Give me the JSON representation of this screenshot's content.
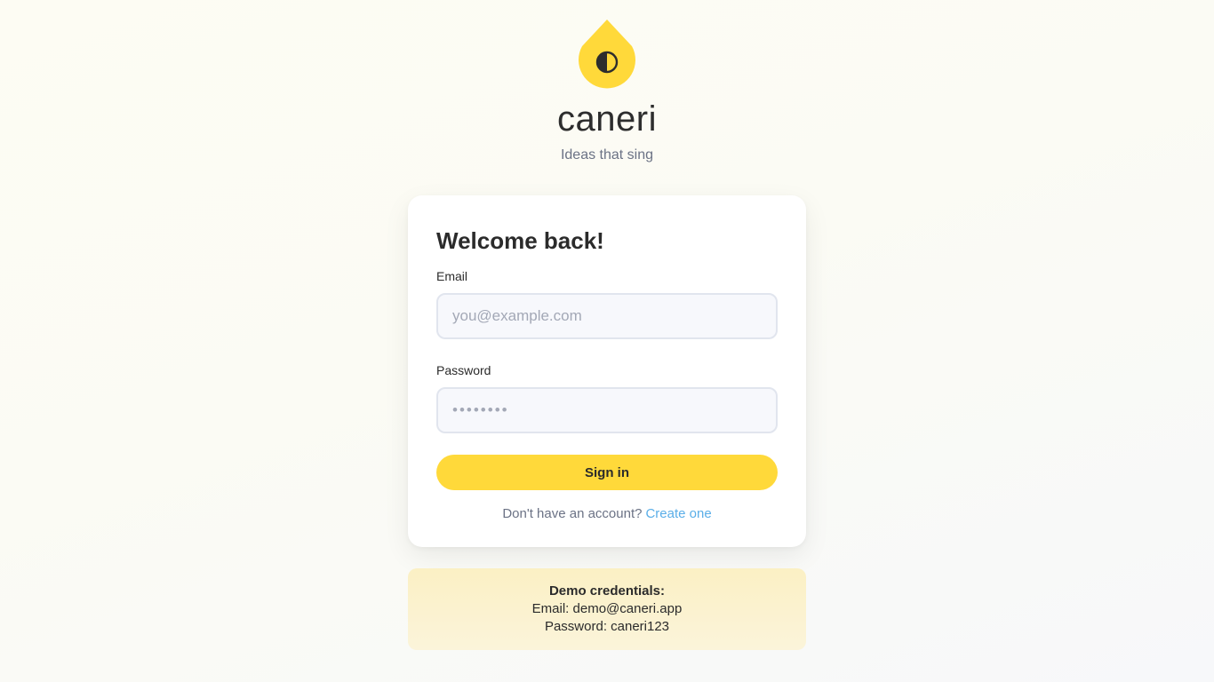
{
  "brand": {
    "name": "caneri",
    "tagline": "Ideas that sing",
    "logo_icon": "contrast-half-circle-icon",
    "accent_color": "#ffd93a"
  },
  "login": {
    "title": "Welcome back!",
    "email_label": "Email",
    "email_placeholder": "you@example.com",
    "email_value": "",
    "password_label": "Password",
    "password_placeholder": "••••••••",
    "password_value": "",
    "submit_label": "Sign in",
    "signup_prompt": "Don't have an account?",
    "signup_link": "Create one",
    "link_color": "#5aaee8"
  },
  "demo": {
    "title": "Demo credentials:",
    "email_line": "Email: demo@caneri.app",
    "password_line": "Password: caneri123"
  }
}
